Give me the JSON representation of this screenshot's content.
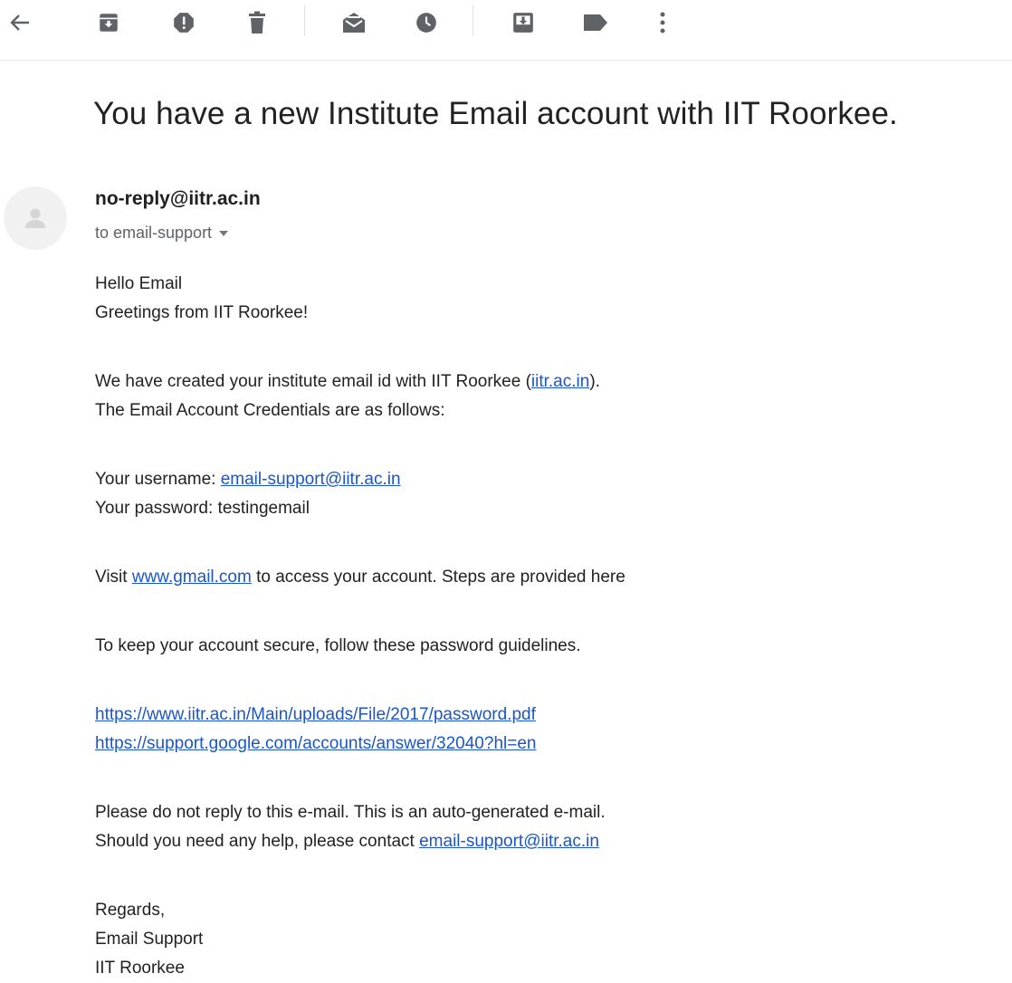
{
  "toolbar": {
    "icons": [
      "back-arrow-icon",
      "archive-icon",
      "report-spam-icon",
      "delete-icon",
      "mark-unread-icon",
      "snooze-icon",
      "move-to-icon",
      "label-icon",
      "more-vert-icon"
    ],
    "colors": {
      "icon": "#5f6368",
      "divider": "#e0e0e0"
    }
  },
  "email": {
    "subject": "You have a new Institute Email account with IIT Roorkee.",
    "sender": "no-reply@iitr.ac.in",
    "recipient": "to email-support",
    "body": {
      "greeting": "Hello Email",
      "greetings_line": "Greetings from IIT Roorkee!",
      "created_prefix": "We have created your institute email id with IIT Roorkee (",
      "created_link": "iitr.ac.in",
      "created_suffix": ").",
      "credentials_intro": "The Email Account Credentials are as follows:",
      "username_label": "Your username: ",
      "username_value": "email-support@iitr.ac.in",
      "password_line": "Your password: testingemail",
      "visit_prefix": "Visit ",
      "visit_link": "www.gmail.com",
      "visit_suffix": " to access your account. Steps are provided here",
      "secure_line": "To keep your account secure, follow these password guidelines.",
      "link1": "https://www.iitr.ac.in/Main/uploads/File/2017/password.pdf",
      "link2": "https://support.google.com/accounts/answer/32040?hl=en",
      "noreply_line": "Please do not reply to this e-mail. This is an auto-generated e-mail.",
      "help_prefix": "Should you need any help, please contact ",
      "help_link": "email-support@iitr.ac.in",
      "regards": "Regards,",
      "sign_team": "Email Support",
      "sign_org": "IIT Roorkee"
    },
    "colors": {
      "link": "#1a56c9",
      "text": "#222222",
      "muted": "#5f6368"
    }
  }
}
